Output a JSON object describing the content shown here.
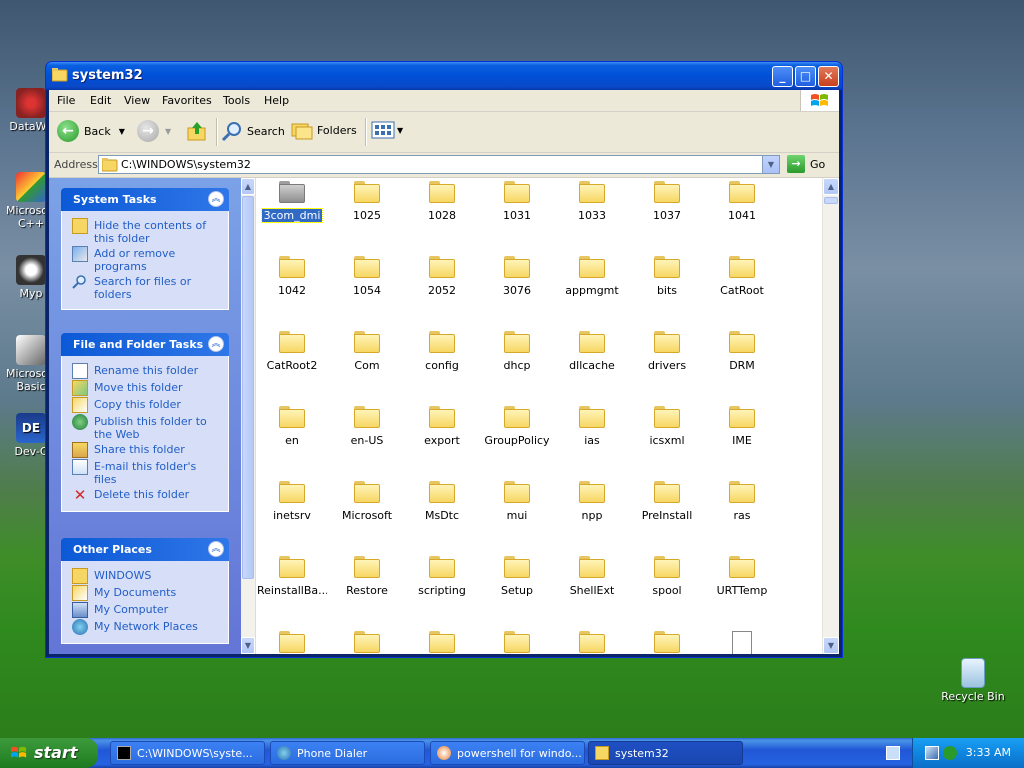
{
  "desktop": {
    "icons": [
      {
        "label": "DataWa"
      },
      {
        "label": "Microsoft C++"
      },
      {
        "label": "Myp"
      },
      {
        "label": "Microsoft Basic"
      },
      {
        "label": "Dev-C"
      }
    ],
    "recycle_bin": "Recycle Bin"
  },
  "window": {
    "title": "system32",
    "menu": [
      "File",
      "Edit",
      "View",
      "Favorites",
      "Tools",
      "Help"
    ],
    "toolbar": {
      "back": "Back",
      "search": "Search",
      "folders": "Folders"
    },
    "address": {
      "label": "Address",
      "value": "C:\\WINDOWS\\system32",
      "go": "Go"
    }
  },
  "tasks": {
    "system_tasks": {
      "title": "System Tasks",
      "items": [
        "Hide the contents of this folder",
        "Add or remove programs",
        "Search for files or folders"
      ]
    },
    "file_folder_tasks": {
      "title": "File and Folder Tasks",
      "items": [
        "Rename this folder",
        "Move this folder",
        "Copy this folder",
        "Publish this folder to the Web",
        "Share this folder",
        "E-mail this folder's files",
        "Delete this folder"
      ]
    },
    "other_places": {
      "title": "Other Places",
      "items": [
        "WINDOWS",
        "My Documents",
        "My Computer",
        "My Network Places"
      ]
    }
  },
  "files": [
    "3com_dmi",
    "1025",
    "1028",
    "1031",
    "1033",
    "1037",
    "1041",
    "1042",
    "1054",
    "2052",
    "3076",
    "appmgmt",
    "bits",
    "CatRoot",
    "CatRoot2",
    "Com",
    "config",
    "dhcp",
    "dllcache",
    "drivers",
    "DRM",
    "en",
    "en-US",
    "export",
    "GroupPolicy",
    "ias",
    "icsxml",
    "IME",
    "inetsrv",
    "Microsoft",
    "MsDtc",
    "mui",
    "npp",
    "PreInstall",
    "ras",
    "ReinstallBa...",
    "Restore",
    "scripting",
    "Setup",
    "ShellExt",
    "spool",
    "URTTemp"
  ],
  "taskbar": {
    "start": "start",
    "buttons": [
      "C:\\WINDOWS\\syste...",
      "Phone Dialer",
      "powershell for windo...",
      "system32"
    ],
    "clock": "3:33 AM"
  }
}
